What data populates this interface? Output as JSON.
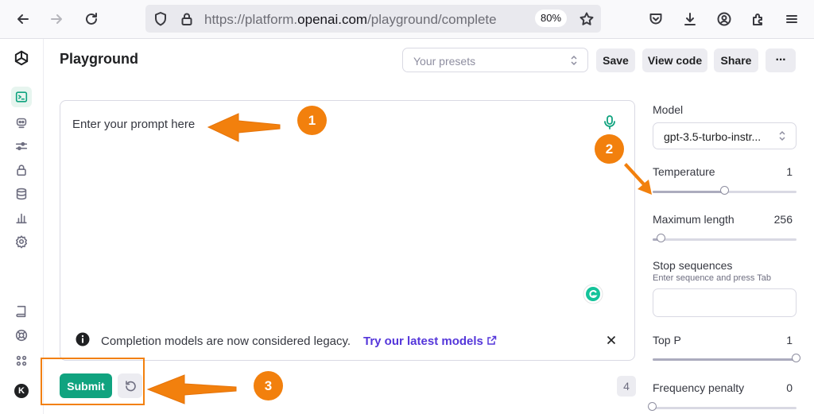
{
  "browser": {
    "url_prefix": "https://platform.",
    "url_domain": "openai.com",
    "url_path": "/playground/complete",
    "zoom": "80%"
  },
  "app": {
    "title": "Playground",
    "presets_placeholder": "Your presets",
    "save_label": "Save",
    "view_code_label": "View code",
    "share_label": "Share",
    "more_label": "···",
    "user_initial": "K"
  },
  "editor": {
    "prompt_text": "Enter your prompt here",
    "notice_text": "Completion models are now considered legacy.",
    "notice_link": "Try our latest models",
    "submit_label": "Submit",
    "token_count": "4"
  },
  "settings": {
    "model_label": "Model",
    "model_value": "gpt-3.5-turbo-instr...",
    "temperature_label": "Temperature",
    "temperature_value": "1",
    "temperature_fraction": 0.5,
    "max_length_label": "Maximum length",
    "max_length_value": "256",
    "max_length_fraction": 0.06,
    "stop_label": "Stop sequences",
    "stop_hint": "Enter sequence and press Tab",
    "top_p_label": "Top P",
    "top_p_value": "1",
    "top_p_fraction": 1.0,
    "freq_label": "Frequency penalty",
    "freq_value": "0",
    "freq_fraction": 0.0
  },
  "annotations": {
    "badge1": "1",
    "badge2": "2",
    "badge3": "3",
    "accent": "#f2800d"
  }
}
